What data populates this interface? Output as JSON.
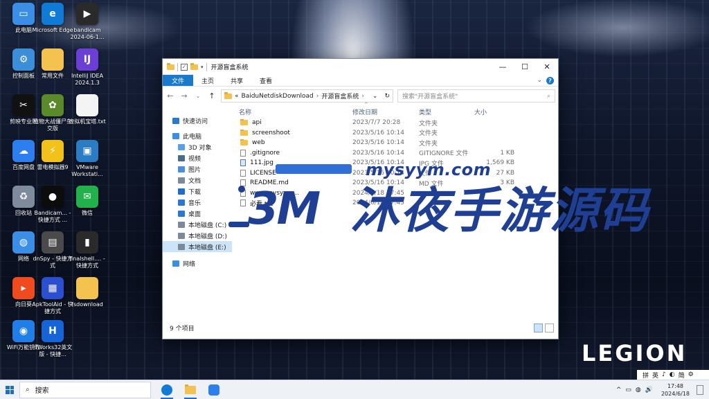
{
  "desktop": {
    "brand": "LEGION",
    "icons": [
      {
        "label": "此电脑",
        "icon": "this-pc-icon",
        "color": "#3a8ee6",
        "glyph": "▭"
      },
      {
        "label": "Microsoft Edge",
        "icon": "edge-icon",
        "color": "#0f7bd6",
        "glyph": "e"
      },
      {
        "label": "bandicam 2024-06-1...",
        "icon": "video-file-icon",
        "color": "#2a2a2a",
        "glyph": "▶"
      },
      {
        "label": "控制面板",
        "icon": "control-panel-icon",
        "color": "#3b8ed8",
        "glyph": "⚙"
      },
      {
        "label": "常用文件",
        "icon": "folder-icon",
        "color": "#f3c24f",
        "glyph": ""
      },
      {
        "label": "IntelliJ IDEA 2024.1.3",
        "icon": "intellij-icon",
        "color": "#6b3fd6",
        "glyph": "IJ"
      },
      {
        "label": "剪映专业版",
        "icon": "capcut-icon",
        "color": "#111111",
        "glyph": "✂"
      },
      {
        "label": "植物大战僵尸杂交版",
        "icon": "game-icon",
        "color": "#5a8a2a",
        "glyph": "✿"
      },
      {
        "label": "虚拟机宝塔.txt",
        "icon": "text-file-icon",
        "color": "#f4f4f4",
        "glyph": ""
      },
      {
        "label": "百度网盘",
        "icon": "baidu-netdisk-icon",
        "color": "#2d7ff0",
        "glyph": "☁"
      },
      {
        "label": "雷电模拟器9",
        "icon": "emulator-icon",
        "color": "#f2c21a",
        "glyph": "⚡"
      },
      {
        "label": "VMware Workstati...",
        "icon": "vmware-icon",
        "color": "#2b7cc4",
        "glyph": "▣"
      },
      {
        "label": "回收站",
        "icon": "recycle-bin-icon",
        "color": "#7d8b9c",
        "glyph": "♻"
      },
      {
        "label": "Bandicam... - 快捷方式 ...",
        "icon": "bandicam-icon",
        "color": "#0c0c0c",
        "glyph": "●"
      },
      {
        "label": "微信",
        "icon": "wechat-icon",
        "color": "#21b24c",
        "glyph": "✉"
      },
      {
        "label": "网络",
        "icon": "network-icon",
        "color": "#3a8ee6",
        "glyph": "◍"
      },
      {
        "label": "dnSpy - 快捷方式",
        "icon": "dnspy-icon",
        "color": "#4a4a4a",
        "glyph": "▤"
      },
      {
        "label": "finalshell.... - 快捷方式",
        "icon": "finalshell-icon",
        "color": "#2a2a2a",
        "glyph": "▮"
      },
      {
        "label": "向日葵",
        "icon": "sunlogin-icon",
        "color": "#ef4b1f",
        "glyph": "▸"
      },
      {
        "label": "ApkToolAid - 快捷方式",
        "icon": "apktool-icon",
        "color": "#2a4fd0",
        "glyph": "▦"
      },
      {
        "label": "fsdownload",
        "icon": "folder-icon",
        "color": "#f3c24f",
        "glyph": ""
      },
      {
        "label": "WiFi万能钥匙",
        "icon": "wifi-key-icon",
        "color": "#1f7ee8",
        "glyph": "◉"
      },
      {
        "label": "HWorks32英文版 - 快捷...",
        "icon": "hworks-icon",
        "color": "#1565d8",
        "glyph": "H"
      }
    ]
  },
  "explorer": {
    "title": "开源盲盒系统",
    "ribbon_tabs": [
      "文件",
      "主页",
      "共享",
      "查看"
    ],
    "help": "?",
    "nav_buttons": [
      "←",
      "→",
      "⌄",
      "↑"
    ],
    "address": {
      "overflow": "«",
      "crumbs": [
        "BaiduNetdiskDownload",
        "开源盲盒系统"
      ],
      "separator": "›",
      "dropdown": "⌄",
      "refresh": "↻"
    },
    "search_placeholder": "搜索\"开源盲盒系统\"",
    "search_icon": "⌕",
    "sidebar": [
      {
        "label": "快速访问",
        "icon": "quick-access-icon",
        "color": "#2b78d0"
      },
      {
        "label": "此电脑",
        "icon": "this-pc-icon",
        "color": "#3a8ee6"
      },
      {
        "label": "3D 对象",
        "icon": "3d-objects-icon",
        "color": "#5aa0e6"
      },
      {
        "label": "视频",
        "icon": "videos-icon",
        "color": "#4a6b8a"
      },
      {
        "label": "图片",
        "icon": "pictures-icon",
        "color": "#4a90d9"
      },
      {
        "label": "文档",
        "icon": "documents-icon",
        "color": "#7a8a9a"
      },
      {
        "label": "下载",
        "icon": "downloads-icon",
        "color": "#1e6ec7"
      },
      {
        "label": "音乐",
        "icon": "music-icon",
        "color": "#2b78d0"
      },
      {
        "label": "桌面",
        "icon": "desktop-icon",
        "color": "#2b78d0"
      },
      {
        "label": "本地磁盘 (C:)",
        "icon": "drive-icon",
        "color": "#7a8a9a"
      },
      {
        "label": "本地磁盘 (D:)",
        "icon": "drive-icon",
        "color": "#7a8a9a"
      },
      {
        "label": "本地磁盘 (E:)",
        "icon": "drive-icon",
        "color": "#7a8a9a"
      },
      {
        "label": "网络",
        "icon": "network-icon",
        "color": "#3a8ee6"
      }
    ],
    "columns": [
      "名称",
      "修改日期",
      "类型",
      "大小"
    ],
    "sort_indicator": "^",
    "files": [
      {
        "name": "api",
        "date": "2023/7/7 20:28",
        "type": "文件夹",
        "size": "",
        "kind": "folder"
      },
      {
        "name": "screenshoot",
        "date": "2023/5/16 10:14",
        "type": "文件夹",
        "size": "",
        "kind": "folder"
      },
      {
        "name": "web",
        "date": "2023/5/16 10:14",
        "type": "文件夹",
        "size": "",
        "kind": "folder"
      },
      {
        "name": ".gitignore",
        "date": "2023/5/16 10:14",
        "type": "GITIGNORE 文件",
        "size": "1 KB",
        "kind": "file"
      },
      {
        "name": "111.jpg",
        "date": "2023/5/16 10:14",
        "type": "JPG 文件",
        "size": "1,569 KB",
        "kind": "jpg"
      },
      {
        "name": "LICENSE",
        "date": "2023/5/16 10:14",
        "type": "文件",
        "size": "27 KB",
        "kind": "file"
      },
      {
        "name": "README.md",
        "date": "2023/5/16 10:14",
        "type": "MD 文件",
        "size": "3 KB",
        "kind": "file"
      },
      {
        "name": "www.mysyym...",
        "date": "2024/6/18 17:45",
        "type": "",
        "size": "",
        "kind": "file"
      },
      {
        "name": "必看.txt",
        "date": "2024/6/18 17:45",
        "type": "",
        "size": "",
        "kind": "file"
      }
    ],
    "status": "9 个项目"
  },
  "watermark": {
    "url": "mysyym.com",
    "logo": "3M",
    "text": "沐夜手游源码"
  },
  "taskbar": {
    "search": "搜索",
    "search_icon": "⌕",
    "tray_expand": "^",
    "clock_time": "17:48",
    "clock_date": "2024/6/18",
    "ime": [
      "拼",
      "英",
      "♪",
      "◐",
      "简",
      "⚙"
    ],
    "tray_icons": [
      "▭",
      "◍",
      "🔊"
    ]
  },
  "colors": {
    "accent": "#1979ca",
    "watermark": "#1e3f94"
  }
}
